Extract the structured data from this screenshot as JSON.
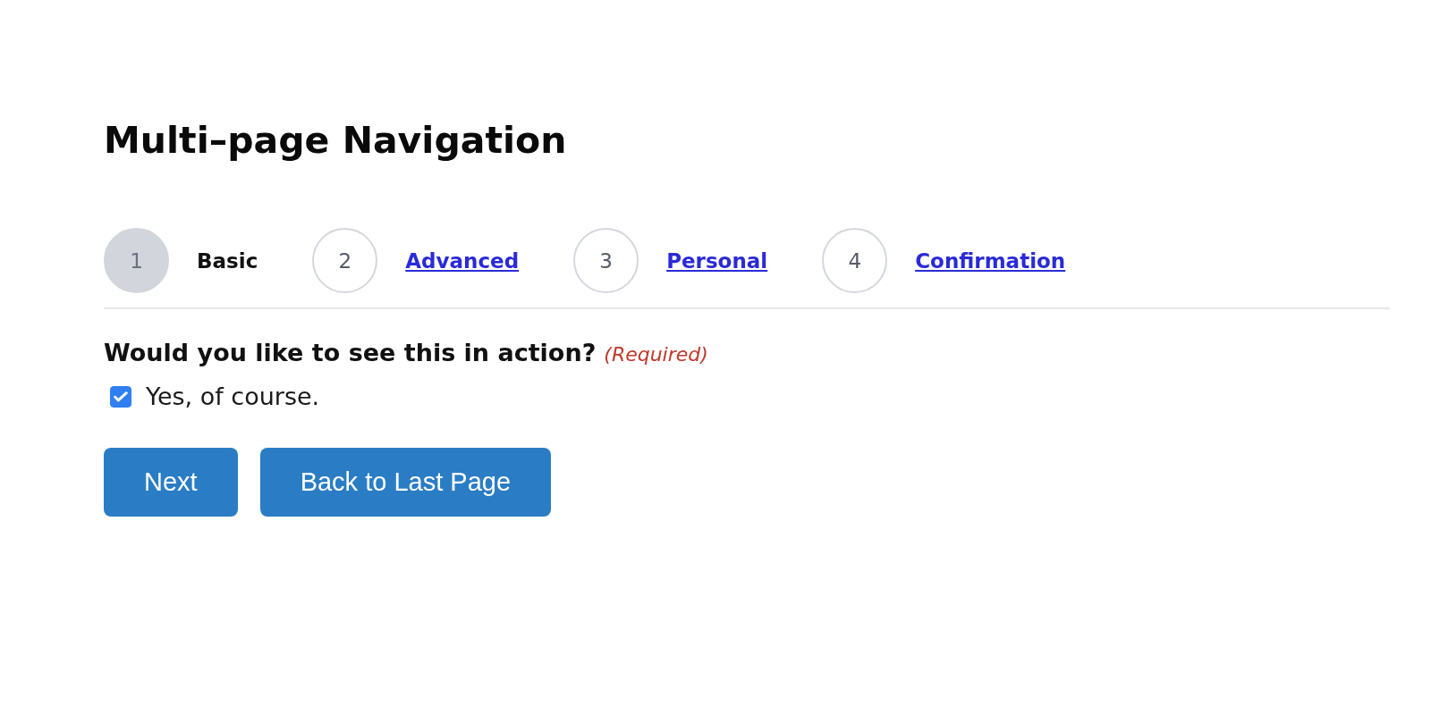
{
  "title": "Multi–page Navigation",
  "steps": [
    {
      "number": "1",
      "label": "Basic",
      "selected": true
    },
    {
      "number": "2",
      "label": "Advanced",
      "selected": false
    },
    {
      "number": "3",
      "label": "Personal",
      "selected": false
    },
    {
      "number": "4",
      "label": "Confirmation",
      "selected": false
    }
  ],
  "question": {
    "label": "Would you like to see this in action?",
    "required": "(Required)"
  },
  "choices": [
    {
      "label": "Yes, of course.",
      "checked": true
    }
  ],
  "buttons": [
    {
      "label": "Next"
    },
    {
      "label": "Back to Last Page"
    }
  ]
}
